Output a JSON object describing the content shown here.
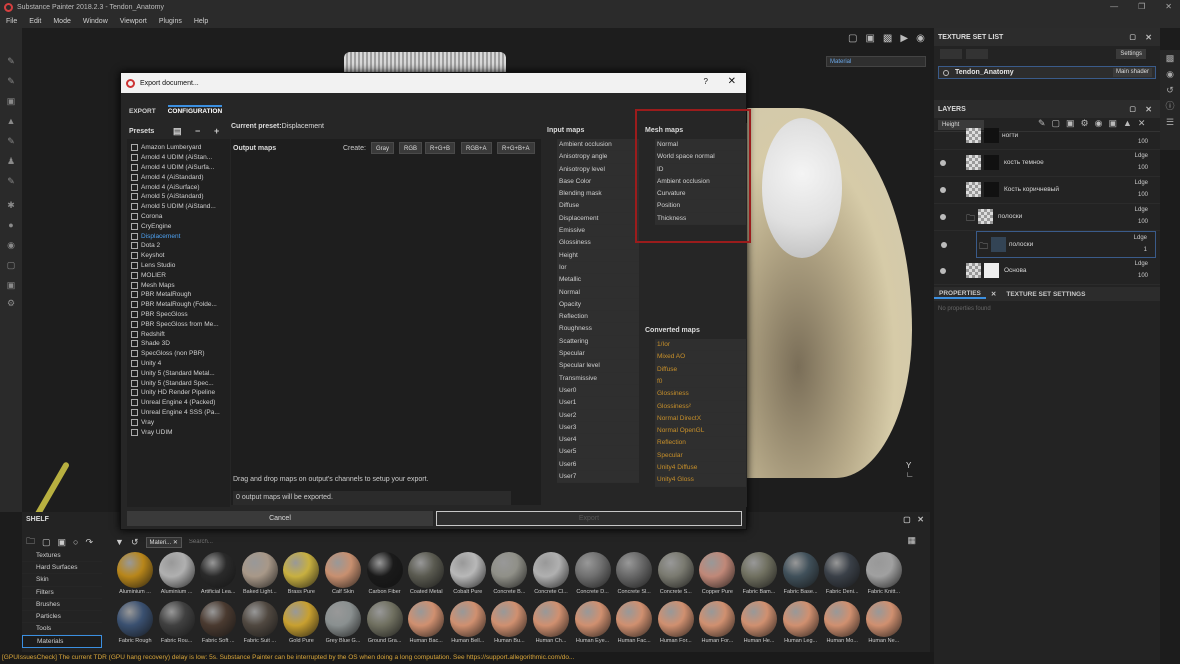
{
  "window": {
    "title": "Substance Painter 2018.2.3 - Tendon_Anatomy"
  },
  "menu": [
    "File",
    "Edit",
    "Mode",
    "Window",
    "Viewport",
    "Plugins",
    "Help"
  ],
  "viewport": {
    "material_select": "Material"
  },
  "texture_set_list": {
    "title": "TEXTURE SET LIST",
    "settings": "Settings",
    "item": "Tendon_Anatomy",
    "shader": "Main shader"
  },
  "layers": {
    "title": "LAYERS",
    "channel": "Height",
    "items": [
      {
        "name": "ногти",
        "blend": "",
        "opacity": "100"
      },
      {
        "name": "кость темное",
        "blend": "Ldge",
        "opacity": "100"
      },
      {
        "name": "Кость коричневый",
        "blend": "Ldge",
        "opacity": "100"
      },
      {
        "name": "полоски",
        "blend": "Ldge",
        "opacity": "100"
      },
      {
        "name": "полоски",
        "blend": "Ldge",
        "opacity": "1"
      },
      {
        "name": "Основа",
        "blend": "Ldge",
        "opacity": "100"
      }
    ]
  },
  "properties": {
    "tab1": "PROPERTIES",
    "tab2": "TEXTURE SET SETTINGS",
    "empty": "No properties found"
  },
  "dialog": {
    "title": "Export document...",
    "tabs": [
      "EXPORT",
      "CONFIGURATION"
    ],
    "presets_label": "Presets",
    "current_preset_label": "Current preset:",
    "current_preset": "Displacement",
    "output_maps": "Output maps",
    "create_label": "Create:",
    "create_buttons": [
      "Gray",
      "RGB",
      "R+G+B",
      "RGB+A",
      "R+G+B+A"
    ],
    "drag_hint": "Drag and drop maps on output's channels to setup your export.",
    "count": "0 output maps will be exported.",
    "presets": [
      "Amazon Lumberyard",
      "Arnold 4  UDIM (AiStan...",
      "Arnold 4  UDIM (AiSurfa...",
      "Arnold 4 (AiStandard)",
      "Arnold 4 (AiSurface)",
      "Arnold 5 (AiStandard)",
      "Arnold 5 UDIM (AiStand...",
      "Corona",
      "CryEngine",
      "Displacement",
      "Dota 2",
      "Keyshot",
      "Lens Studio",
      "MOLIER",
      "Mesh Maps",
      "PBR MetalRough",
      "PBR MetalRough (Folde...",
      "PBR SpecGloss",
      "PBR SpecGloss from Me...",
      "Redshift",
      "Shade 3D",
      "SpecGloss (non PBR)",
      "Unity 4",
      "Unity 5 (Standard Metal...",
      "Unity 5 (Standard Spec...",
      "Unity HD Render Pipeline",
      "Unreal Engine 4 (Packed)",
      "Unreal Engine 4 SSS (Pa...",
      "Vray",
      "Vray UDIM"
    ],
    "selected_preset": "Displacement",
    "input_maps_label": "Input maps",
    "input_maps": [
      "Ambient occlusion",
      "Anisotropy angle",
      "Anisotropy level",
      "Base Color",
      "Blending mask",
      "Diffuse",
      "Displacement",
      "Emissive",
      "Glossiness",
      "Height",
      "Ior",
      "Metallic",
      "Normal",
      "Opacity",
      "Reflection",
      "Roughness",
      "Scattering",
      "Specular",
      "Specular level",
      "Transmissive",
      "User0",
      "User1",
      "User2",
      "User3",
      "User4",
      "User5",
      "User6",
      "User7"
    ],
    "mesh_maps_label": "Mesh maps",
    "mesh_maps": [
      "Normal",
      "World space normal",
      "ID",
      "Ambient occlusion",
      "Curvature",
      "Position",
      "Thickness"
    ],
    "converted_maps_label": "Converted maps",
    "converted_maps": [
      "1/Ior",
      "Mixed AO",
      "Diffuse",
      "f0",
      "Glossiness",
      "Glossiness²",
      "Normal DirectX",
      "Normal OpenGL",
      "Reflection",
      "Specular",
      "Unity4 Diffuse",
      "Unity4 Gloss"
    ],
    "cancel": "Cancel",
    "export": "Export"
  },
  "shelf": {
    "title": "SHELF",
    "filter_tag": "Materi...",
    "search_placeholder": "Search...",
    "categories": [
      "Textures",
      "Hard Surfaces",
      "Skin",
      "Filters",
      "Brushes",
      "Particles",
      "Tools",
      "Materials"
    ],
    "selected_category": "Materials",
    "materials": [
      {
        "name": "Aluminium ...",
        "color": "#b8861a"
      },
      {
        "name": "Aluminium ...",
        "color": "#b0b0b0"
      },
      {
        "name": "Artificial Lea...",
        "color": "#2a2a2a"
      },
      {
        "name": "Baked Light...",
        "color": "#a89888"
      },
      {
        "name": "Brass Pure",
        "color": "#c8b040"
      },
      {
        "name": "Calf Skin",
        "color": "#c89070"
      },
      {
        "name": "Carbon Fiber",
        "color": "#1a1a1a"
      },
      {
        "name": "Coated Metal",
        "color": "#5a5a50"
      },
      {
        "name": "Cobalt Pure",
        "color": "#b8b8b8"
      },
      {
        "name": "Concrete B...",
        "color": "#909088"
      },
      {
        "name": "Concrete Cl...",
        "color": "#b0b0b0"
      },
      {
        "name": "Concrete D...",
        "color": "#707070"
      },
      {
        "name": "Concrete Sl...",
        "color": "#686868"
      },
      {
        "name": "Concrete S...",
        "color": "#7a7a70"
      },
      {
        "name": "Copper Pure",
        "color": "#c08878"
      },
      {
        "name": "Fabric Bam...",
        "color": "#707060"
      },
      {
        "name": "Fabric Base...",
        "color": "#40505a"
      },
      {
        "name": "Fabric Deni...",
        "color": "#3a4048"
      },
      {
        "name": "Fabric Knitt...",
        "color": "#a0a0a0"
      },
      {
        "name": "Fabric Rough",
        "color": "#3a5070"
      },
      {
        "name": "Fabric Rou...",
        "color": "#404040"
      },
      {
        "name": "Fabric Soft ...",
        "color": "#4a3a30"
      },
      {
        "name": "Fabric Suit ...",
        "color": "#504840"
      },
      {
        "name": "Gold Pure",
        "color": "#c8a030"
      },
      {
        "name": "Grey Blue G...",
        "color": "#8a9090"
      },
      {
        "name": "Ground Gra...",
        "color": "#707060"
      },
      {
        "name": "Human Bac...",
        "color": "#d09070"
      },
      {
        "name": "Human Bell...",
        "color": "#d09070"
      },
      {
        "name": "Human Bu...",
        "color": "#d09070"
      },
      {
        "name": "Human Ch...",
        "color": "#d09070"
      },
      {
        "name": "Human Eye...",
        "color": "#d09070"
      },
      {
        "name": "Human Fac...",
        "color": "#d09070"
      },
      {
        "name": "Human For...",
        "color": "#d09070"
      },
      {
        "name": "Human For...",
        "color": "#d09070"
      },
      {
        "name": "Human He...",
        "color": "#d09070"
      },
      {
        "name": "Human Leg...",
        "color": "#d09070"
      },
      {
        "name": "Human Mo...",
        "color": "#d09070"
      },
      {
        "name": "Human Ne...",
        "color": "#d09070"
      }
    ]
  },
  "status": "[GPUIssuesCheck] The current TDR (GPU hang recovery) delay is low: 5s. Substance Painter can be interrupted by the OS when doing a long computation. See https://support.allegorithmic.com/do..."
}
